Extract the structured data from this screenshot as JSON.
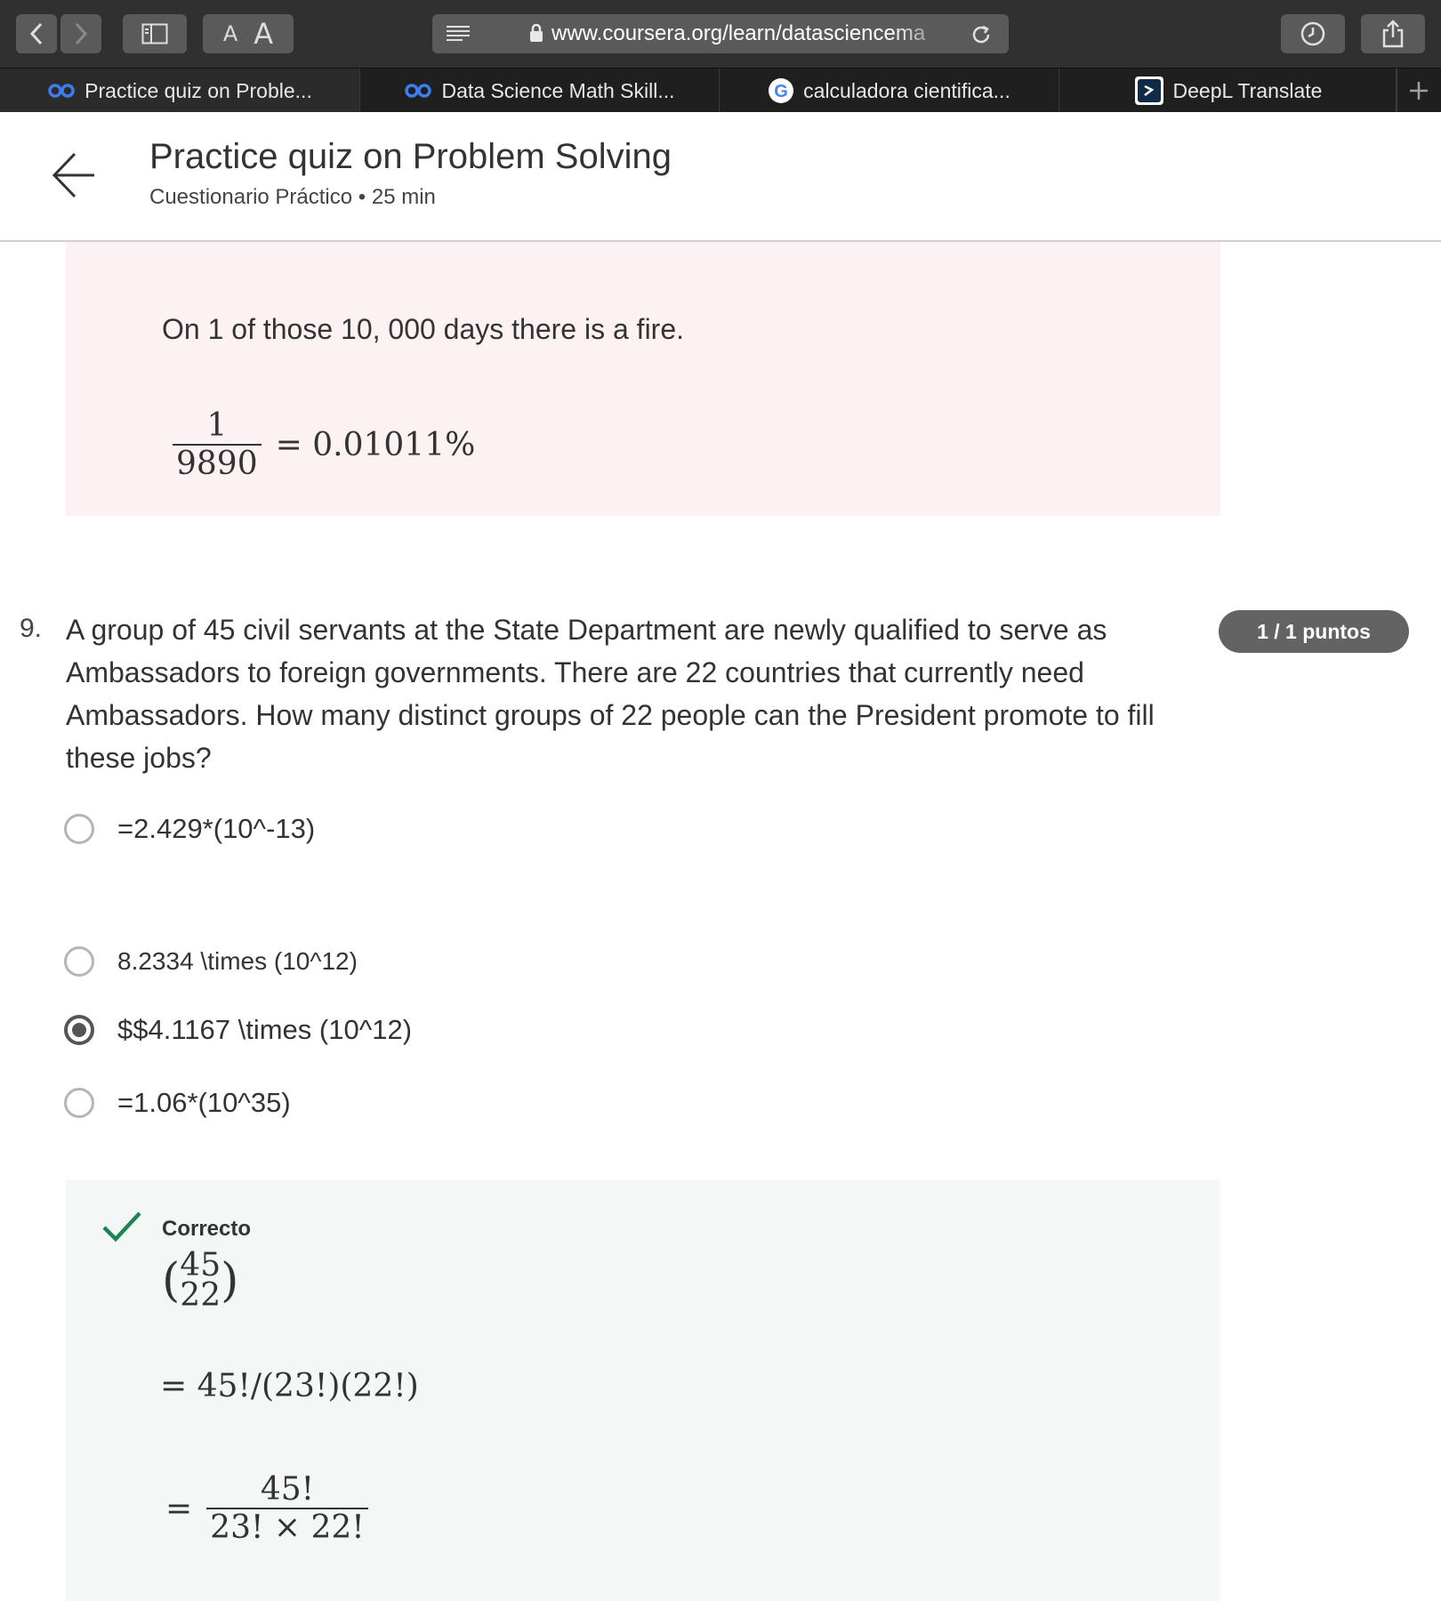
{
  "browser": {
    "url_text": "www.coursera.org/learn/datasciencema",
    "reader_label_small": "A",
    "reader_label_large": "A"
  },
  "tabs": [
    {
      "label": "Practice quiz on Proble...",
      "icon": "coursera-icon"
    },
    {
      "label": "Data Science Math Skill...",
      "icon": "coursera-icon"
    },
    {
      "label": "calculadora cientifica...",
      "icon": "google-icon"
    },
    {
      "label": "DeepL Translate",
      "icon": "deepl-icon"
    }
  ],
  "header": {
    "title": "Practice quiz on Problem Solving",
    "subtitle": "Cuestionario Práctico • 25 min"
  },
  "prev_feedback": {
    "text": "On 1 of those 10, 000 days there is a fire.",
    "frac_num": "1",
    "frac_den": "9890",
    "frac_result": "= 0.01011%"
  },
  "question": {
    "number": "9.",
    "text": "A group of 45 civil servants at the State Department are newly qualified to serve as Ambassadors to foreign governments. There are 22 countries that currently need Ambassadors. How many distinct groups of 22 people can the President promote to fill these jobs?",
    "points": "1 / 1 puntos",
    "options": [
      {
        "label": "=2.429*(10^-13)",
        "selected": false
      },
      {
        "label": "8.2334 \\times (10^12)",
        "selected": false
      },
      {
        "label": "$$4.1167 \\times (10^12)",
        "selected": true
      },
      {
        "label": "=1.06*(10^35)",
        "selected": false
      }
    ]
  },
  "feedback": {
    "status": "Correcto",
    "binom_top": "45",
    "binom_bottom": "22",
    "line1": "= 45!/(23!)(22!)",
    "line2_eq": "=",
    "line2_num": "45!",
    "line2_den": "23! × 22!"
  },
  "colors": {
    "topbar": "#303030",
    "pink_bg": "#fdf2f3",
    "green_bg": "#f3f8f7",
    "check": "#1f8354",
    "badge": "#636363"
  }
}
